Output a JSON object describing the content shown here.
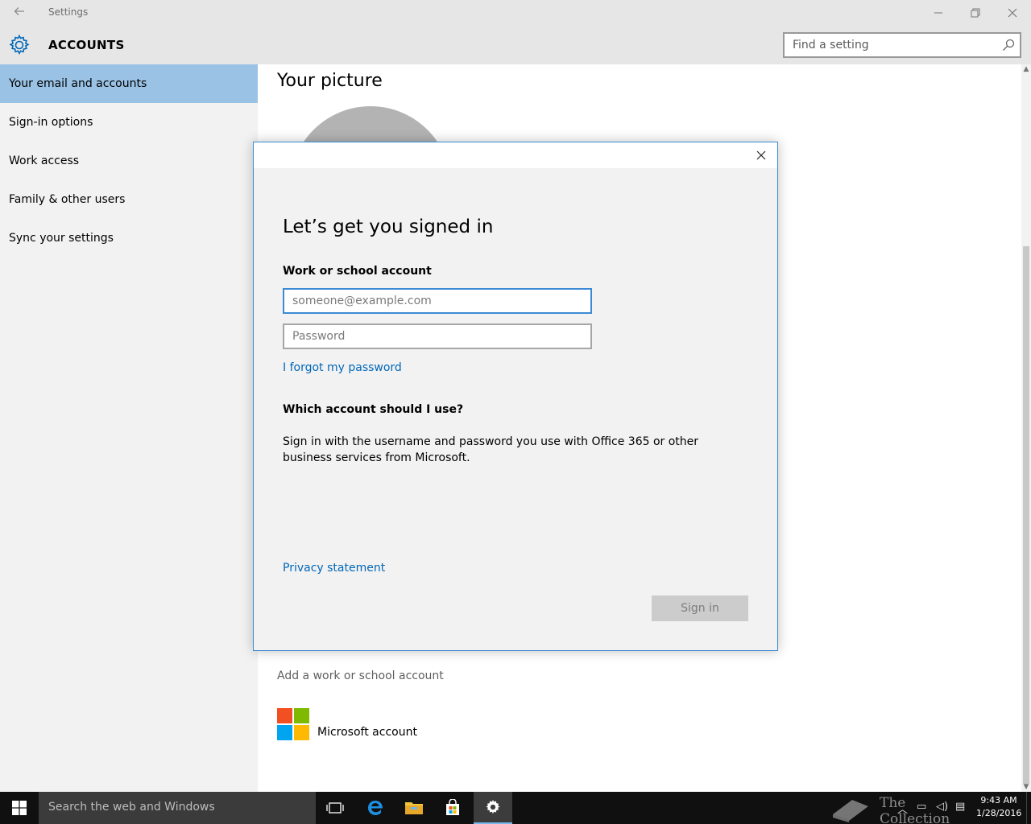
{
  "window": {
    "title": "Settings",
    "back_icon": "back-arrow-icon",
    "controls": [
      "minimize-icon",
      "restore-icon",
      "close-icon"
    ]
  },
  "header": {
    "section_title": "ACCOUNTS",
    "icon": "gear-icon",
    "search_placeholder": "Find a setting",
    "search_icon": "search-icon"
  },
  "sidebar": {
    "items": [
      {
        "label": "Your email and accounts",
        "active": true
      },
      {
        "label": "Sign-in options",
        "active": false
      },
      {
        "label": "Work access",
        "active": false
      },
      {
        "label": "Family & other users",
        "active": false
      },
      {
        "label": "Sync your settings",
        "active": false
      }
    ]
  },
  "content": {
    "picture_heading": "Your picture",
    "add_work_link": "Add a work or school account",
    "microsoft_account_label": "Microsoft account"
  },
  "dialog": {
    "title": "Let’s get you signed in",
    "account_label": "Work or school account",
    "email_placeholder": "someone@example.com",
    "email_value": "",
    "password_placeholder": "Password",
    "password_value": "",
    "forgot_link": "I forgot my password",
    "which_heading": "Which account should I use?",
    "help_text": "Sign in with the username and password you use with Office 365 or other business services from Microsoft.",
    "privacy_link": "Privacy statement",
    "signin_button": "Sign in",
    "close_icon": "close-icon"
  },
  "taskbar": {
    "search_placeholder": "Search the web and Windows",
    "icons": [
      "windows-start-icon",
      "task-view-icon",
      "edge-icon",
      "file-explorer-icon",
      "store-icon",
      "settings-gear-icon"
    ],
    "watermark": "The Collection Book",
    "time": "9:43 AM",
    "date": "1/28/2016"
  },
  "colors": {
    "accent": "#0067b8",
    "active_nav": "#99c2e5",
    "dialog_border": "#3c8ad3",
    "ms_red": "#f25022",
    "ms_green": "#7fba00",
    "ms_blue": "#00a4ef",
    "ms_yellow": "#ffb900"
  }
}
